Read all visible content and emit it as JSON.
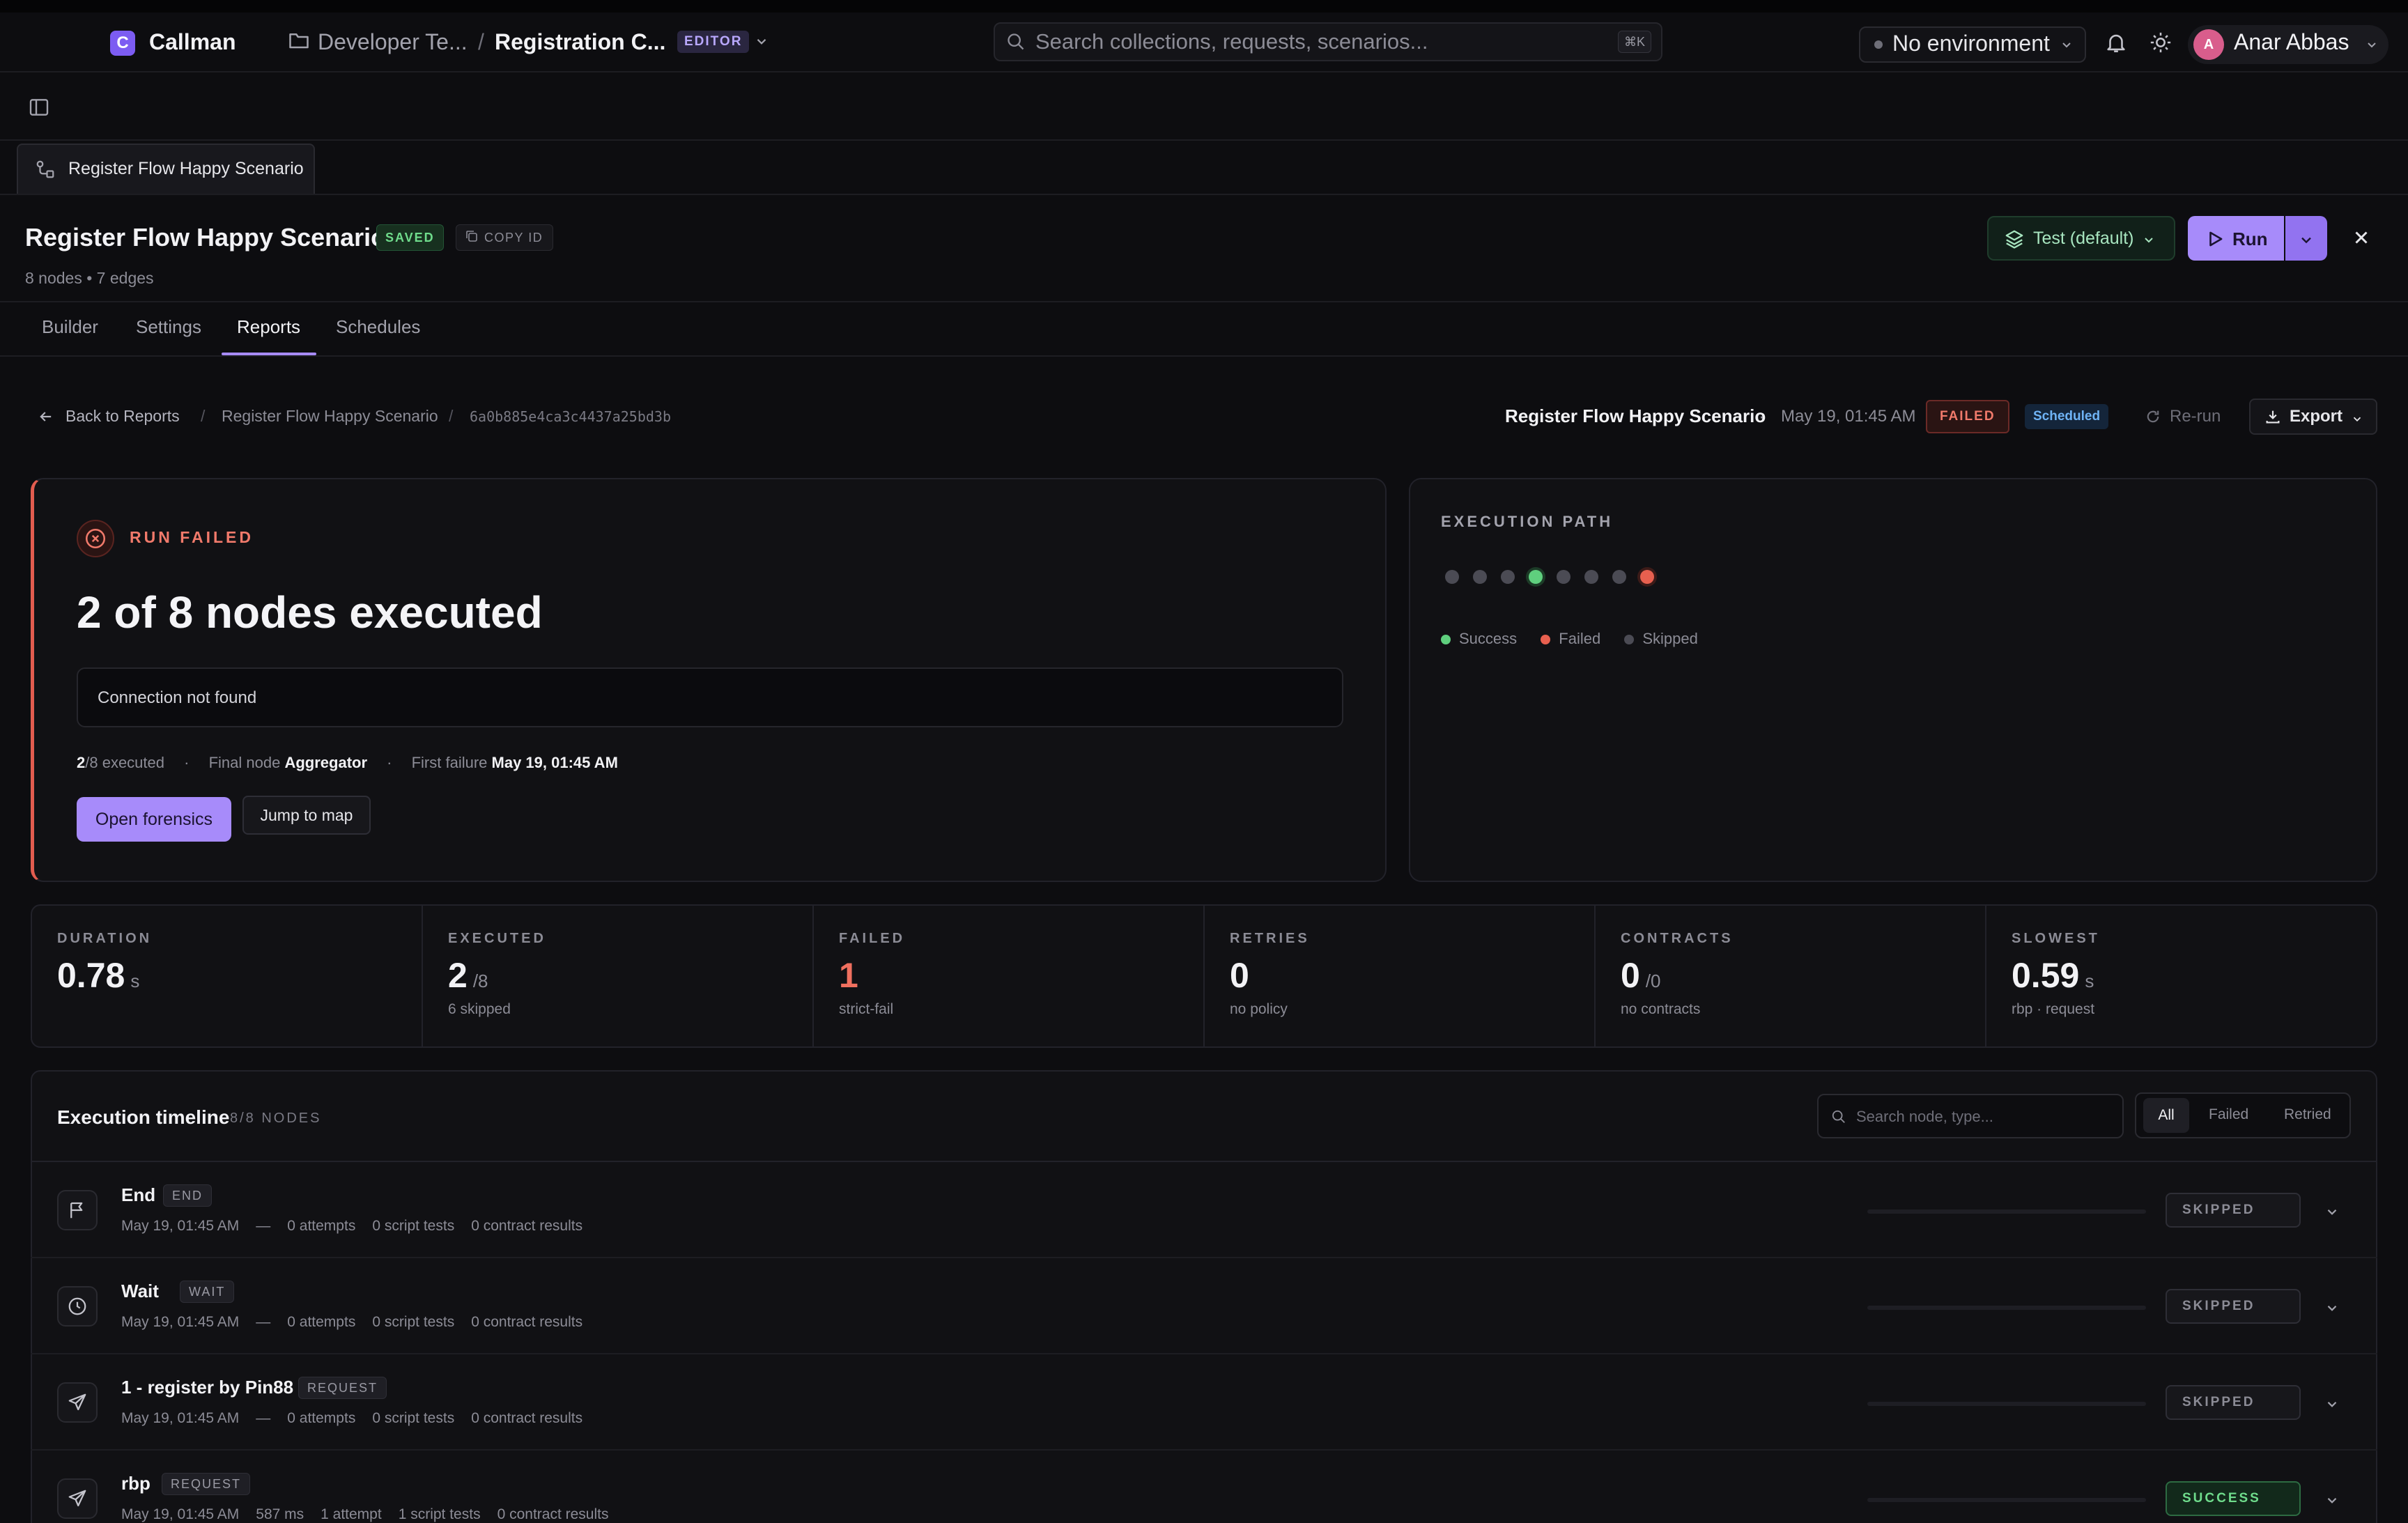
{
  "app": {
    "title": "Callman",
    "logo_letter": "C"
  },
  "breadcrumb": {
    "workspace": "Developer Te...",
    "separator": "/",
    "collection": "Registration C...",
    "mode_badge": "EDITOR"
  },
  "search": {
    "placeholder": "Search collections, requests, scenarios...",
    "shortcut": "⌘K"
  },
  "environment": {
    "label": "No environment"
  },
  "user": {
    "initial": "A",
    "name": "Anar Abbas"
  },
  "doc_tab": {
    "label": "Register Flow Happy Scenario"
  },
  "scenario": {
    "title": "Register Flow Happy Scenario",
    "saved_badge": "SAVED",
    "copy_id_label": "COPY ID",
    "meta": "8 nodes  •  7 edges",
    "env_select": "Test (default)",
    "run_label": "Run"
  },
  "view_tabs": {
    "builder": "Builder",
    "settings": "Settings",
    "reports": "Reports",
    "schedules": "Schedules"
  },
  "report_nav": {
    "back_label": "Back to Reports",
    "sep": "/",
    "scenario": "Register Flow Happy Scenario",
    "run_id": "6a0b885e4ca3c4437a25bd3b"
  },
  "report_header": {
    "title": "Register Flow Happy Scenario",
    "dot": "·",
    "date": "May 19, 01:45 AM",
    "status": "FAILED",
    "trigger": "Scheduled",
    "rerun": "Re-run",
    "export": "Export"
  },
  "failure": {
    "kicker": "RUN FAILED",
    "headline": "2 of 8 nodes executed",
    "message": "Connection not found",
    "executed_value": "2",
    "executed_rest": "/8 executed",
    "final_node_label": "Final node",
    "final_node": "Aggregator",
    "first_failure_label": "First failure",
    "first_failure": "May 19, 01:45 AM",
    "bullet": "·",
    "forensics_btn": "Open forensics",
    "jump_btn": "Jump to map"
  },
  "execution_path": {
    "title": "EXECUTION PATH",
    "nodes": [
      "skipped",
      "skipped",
      "skipped",
      "success",
      "skipped",
      "skipped",
      "skipped",
      "failed"
    ],
    "legend": {
      "success": "Success",
      "failed": "Failed",
      "skipped": "Skipped"
    },
    "colors": {
      "success": "#5fcf7e",
      "failed": "#e8604f",
      "skipped": "#4b4b54"
    }
  },
  "stats": [
    {
      "label": "DURATION",
      "value": "0.78",
      "unit": "s",
      "sub": ""
    },
    {
      "label": "EXECUTED",
      "value": "2",
      "unit": "/8",
      "sub": "6 skipped"
    },
    {
      "label": "FAILED",
      "value": "1",
      "unit": "",
      "sub": "strict-fail"
    },
    {
      "label": "RETRIES",
      "value": "0",
      "unit": "",
      "sub": "no policy"
    },
    {
      "label": "CONTRACTS",
      "value": "0",
      "unit": "/0",
      "sub": "no contracts"
    },
    {
      "label": "SLOWEST",
      "value": "0.59",
      "unit": "s",
      "sub": "rbp · request"
    }
  ],
  "timeline": {
    "title": "Execution timeline",
    "count": "8/8 NODES",
    "search_placeholder": "Search node, type...",
    "filters": {
      "all": "All",
      "failed": "Failed",
      "retried": "Retried"
    },
    "rows": [
      {
        "name": "End",
        "type": "END",
        "time": "May 19, 01:45 AM",
        "duration": "—",
        "attempts": "0 attempts",
        "script": "0 script tests",
        "contracts": "0 contract results",
        "status": "SKIPPED",
        "progress": 0
      },
      {
        "name": "Wait",
        "type": "WAIT",
        "time": "May 19, 01:45 AM",
        "duration": "—",
        "attempts": "0 attempts",
        "script": "0 script tests",
        "contracts": "0 contract results",
        "status": "SKIPPED",
        "progress": 0
      },
      {
        "name": "1 - register by Pin88",
        "type": "REQUEST",
        "time": "May 19, 01:45 AM",
        "duration": "—",
        "attempts": "0 attempts",
        "script": "0 script tests",
        "contracts": "0 contract results",
        "status": "SKIPPED",
        "progress": 0
      },
      {
        "name": "rbp",
        "type": "REQUEST",
        "time": "May 19, 01:45 AM",
        "duration": "587 ms",
        "attempts": "1 attempt",
        "script": "1 script tests",
        "contracts": "0 contract results",
        "status": "SUCCESS",
        "progress": 0
      }
    ]
  }
}
